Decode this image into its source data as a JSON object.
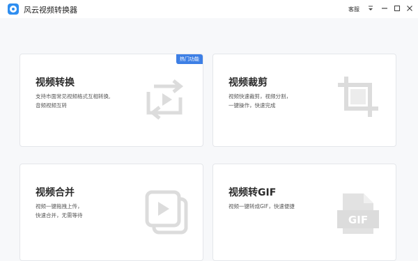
{
  "app": {
    "title": "风云视频转换器",
    "service_label": "客服"
  },
  "cards": [
    {
      "title": "视频转换",
      "desc_line1": "支持市面常见视频格式互相转换,",
      "desc_line2": "音频视频互转",
      "badge": "热门功能",
      "icon": "convert-icon"
    },
    {
      "title": "视频裁剪",
      "desc_line1": "视频快速裁剪，视频分割，",
      "desc_line2": "一键操作，快速完成",
      "icon": "crop-icon"
    },
    {
      "title": "视频合并",
      "desc_line1": "视频一键拖拽上传，",
      "desc_line2": "快速合并，无需等待",
      "icon": "merge-icon"
    },
    {
      "title": "视频转GIF",
      "desc_line1": "视频一键转成GIF，快速便捷",
      "desc_line2": "",
      "icon": "gif-icon",
      "icon_text": "GIF"
    }
  ],
  "colors": {
    "accent": "#3d7fe5",
    "icon_gray": "#dcdcdc",
    "background": "#f7f8fa"
  }
}
